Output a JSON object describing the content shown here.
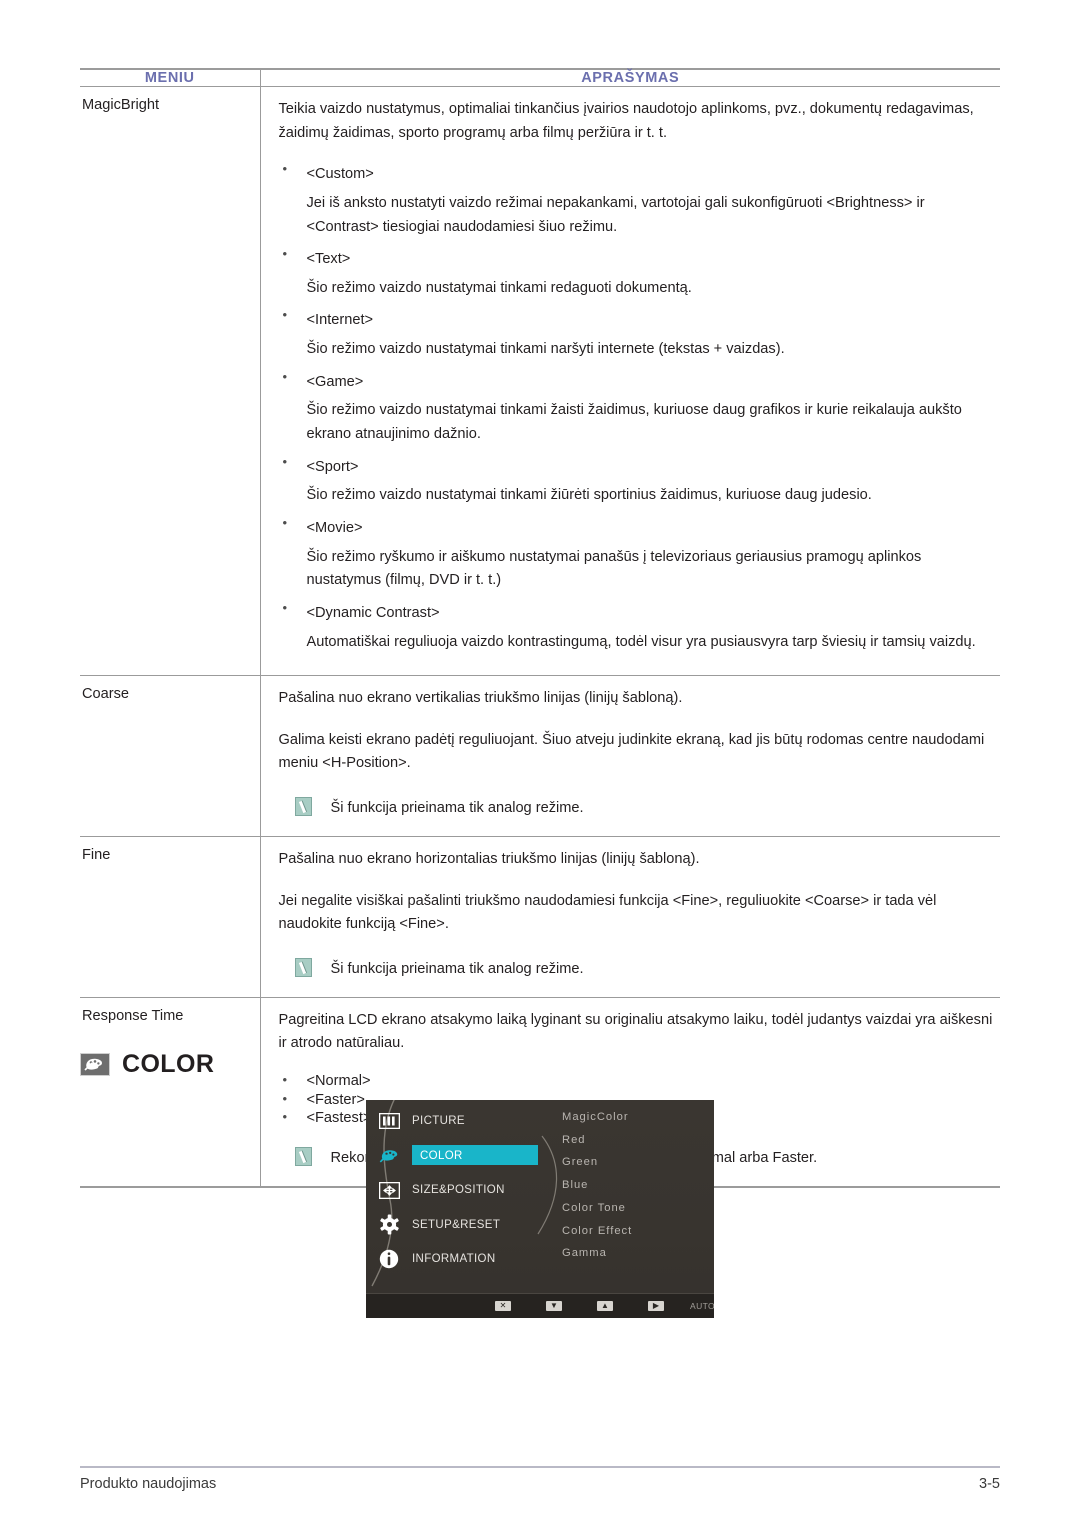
{
  "table": {
    "headers": {
      "menu": "MENIU",
      "description": "APRAŠYMAS"
    },
    "header_color": "#6b6fae",
    "rows": [
      {
        "menu": "MagicBright",
        "intro": "Teikia vaizdo nustatymus, optimaliai tinkančius įvairios naudotojo aplinkoms, pvz., dokumentų redagavimas, žaidimų žaidimas, sporto programų arba filmų peržiūra ir t. t.",
        "bullets": [
          {
            "title": "<Custom>",
            "body": "Jei iš anksto nustatyti vaizdo režimai nepakankami, vartotojai gali sukonfigūruoti <Brightness> ir <Contrast> tiesiogiai naudodamiesi šiuo režimu."
          },
          {
            "title": "<Text>",
            "body": "Šio režimo vaizdo nustatymai tinkami redaguoti dokumentą."
          },
          {
            "title": "<Internet>",
            "body": "Šio režimo vaizdo nustatymai tinkami naršyti internete (tekstas + vaizdas)."
          },
          {
            "title": "<Game>",
            "body": "Šio režimo vaizdo nustatymai tinkami žaisti žaidimus, kuriuose daug grafikos ir kurie reikalauja aukšto ekrano atnaujinimo dažnio."
          },
          {
            "title": "<Sport>",
            "body": "Šio režimo vaizdo nustatymai tinkami žiūrėti sportinius žaidimus, kuriuose daug judesio."
          },
          {
            "title": "<Movie>",
            "body": "Šio režimo ryškumo ir aiškumo nustatymai panašūs į televizoriaus geriausius pramogų aplinkos nustatymus (filmų, DVD ir t. t.)"
          },
          {
            "title": "<Dynamic Contrast>",
            "body": "Automatiškai reguliuoja vaizdo kontrastingumą, todėl visur yra pusiausvyra tarp šviesių ir tamsių vaizdų."
          }
        ]
      },
      {
        "menu": "Coarse",
        "intro": "Pašalina nuo ekrano vertikalias triukšmo linijas (linijų šabloną).",
        "second": "Galima keisti ekrano padėtį reguliuojant. Šiuo atveju judinkite ekraną, kad jis būtų rodomas centre naudodami meniu <H-Position>.",
        "note": "Ši funkcija prieinama tik analog režime."
      },
      {
        "menu": "Fine",
        "intro": "Pašalina nuo ekrano horizontalias triukšmo linijas (linijų šabloną).",
        "second": "Jei negalite visiškai pašalinti triukšmo naudodamiesi funkcija <Fine>, reguliuokite <Coarse> ir tada vėl naudokite funkciją <Fine>.",
        "note": "Ši funkcija prieinama tik analog režime."
      },
      {
        "menu": "Response Time",
        "intro": "Pagreitina LCD ekrano atsakymo laiką lyginant su originaliu atsakymo laiku, todėl judantys vaizdai yra aiškesni ir atrodo natūraliau.",
        "options": [
          "<Normal>",
          "<Faster>",
          "<Fastest>"
        ],
        "note": "Rekomenduojamas nustatymas, kai nežiūrite filmo, yra Normal arba Faster."
      }
    ]
  },
  "section": {
    "icon": "palette-icon",
    "title": "COLOR"
  },
  "osd": {
    "menu_items": [
      {
        "label": "PICTURE",
        "icon": "picture-icon",
        "selected": false
      },
      {
        "label": "COLOR",
        "icon": "palette-icon",
        "selected": true
      },
      {
        "label": "SIZE&POSITION",
        "icon": "move-icon",
        "selected": false
      },
      {
        "label": "SETUP&RESET",
        "icon": "gear-icon",
        "selected": false
      },
      {
        "label": "INFORMATION",
        "icon": "info-icon",
        "selected": false
      }
    ],
    "submenu_items": [
      "MagicColor",
      "Red",
      "Green",
      "Blue",
      "Color Tone",
      "Color Effect",
      "Gamma"
    ],
    "toolbar": {
      "exit": "✕",
      "down": "▼",
      "up": "▲",
      "enter": "▶",
      "auto": "AUTO",
      "power": "⏻"
    },
    "highlight_color": "#19b5c9",
    "background_color": "#38342f"
  },
  "footer": {
    "left": "Produkto naudojimas",
    "right": "3-5"
  }
}
